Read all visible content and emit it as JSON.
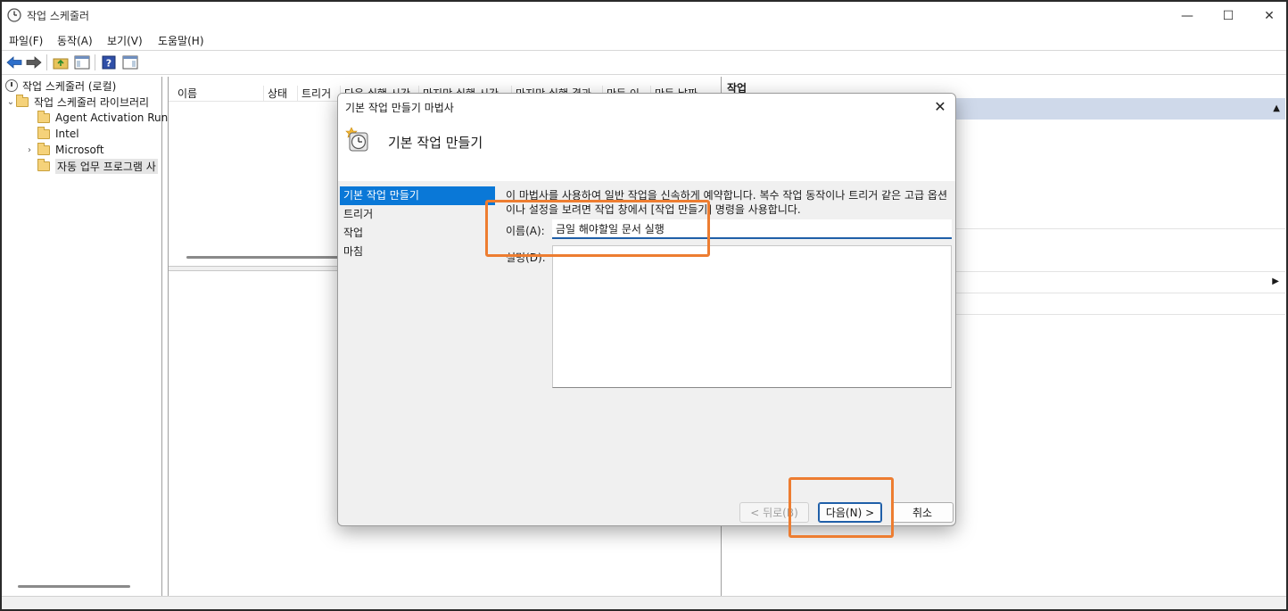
{
  "window": {
    "title": "작업 스케줄러",
    "minimize_glyph": "—",
    "maximize_glyph": "☐",
    "close_glyph": "✕"
  },
  "menubar": {
    "items": [
      "파일(F)",
      "동작(A)",
      "보기(V)",
      "도움말(H)"
    ]
  },
  "toolbar": {
    "icons": [
      "back-arrow-icon",
      "forward-arrow-icon",
      "up-folder-icon",
      "show-hide-tree-icon",
      "help-icon",
      "show-action-pane-icon"
    ]
  },
  "tree": {
    "root": "작업 스케줄러 (로컬)",
    "library": "작업 스케줄러 라이브러리",
    "items": [
      "Agent Activation Run",
      "Intel",
      "Microsoft",
      "자동 업무 프로그램 사"
    ],
    "selected_index": 3
  },
  "task_list": {
    "columns": [
      "이름",
      "상태",
      "트리거",
      "다음 실행 시간",
      "마지막 실행 시간",
      "마지막 실행 결과",
      "만든 이",
      "만든 날짜"
    ]
  },
  "actions_pane": {
    "title": "작업"
  },
  "wizard": {
    "title": "기본 작업 만들기 마법사",
    "header": "기본 작업 만들기",
    "close_glyph": "✕",
    "steps": [
      "기본 작업 만들기",
      "트리거",
      "작업",
      "마침"
    ],
    "active_step": 0,
    "description": "이 마법사를 사용하여 일반 작업을 신속하게 예약합니다. 복수 작업 동작이나 트리거 같은 고급 옵션이나 설정을 보려면 작업 창에서 [작업 만들기] 명령을 사용합니다.",
    "name_label": "이름(A):",
    "name_value": "금일 해야할일 문서 실행",
    "desc_label": "설명(D):",
    "buttons": {
      "back": "< 뒤로(B)",
      "next": "다음(N) >",
      "cancel": "취소"
    }
  },
  "colors": {
    "highlight": "#ed7d31",
    "selection": "#0a78d7",
    "actions_band": "#cfd9ea"
  }
}
